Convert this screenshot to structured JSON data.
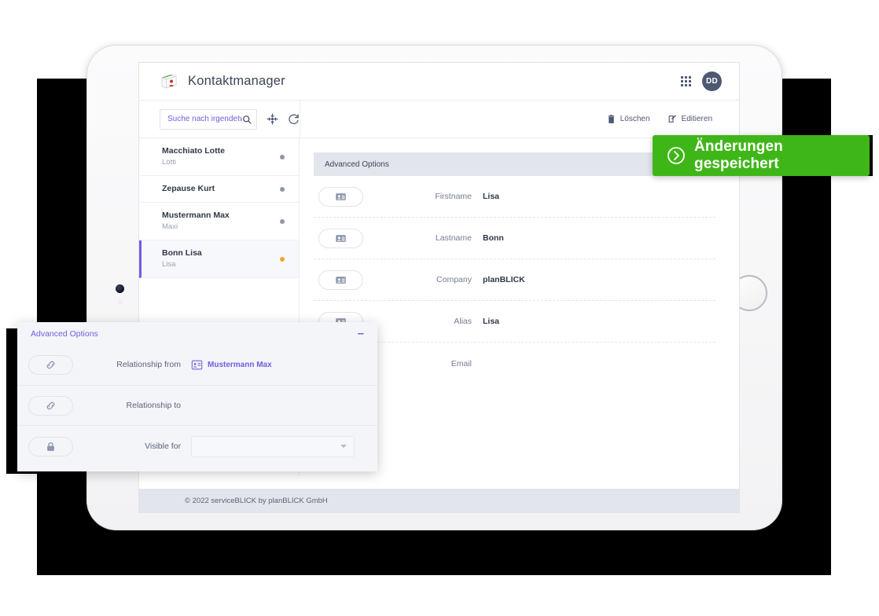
{
  "app": {
    "title": "Kontaktmanager",
    "logo_icon": "contact-book-icon",
    "apps_grid_icon": "apps-grid-icon",
    "avatar_initials": "DD"
  },
  "search": {
    "placeholder": "Suche nach irgendetwas...",
    "value": "",
    "search_icon": "search-icon",
    "add_icon": "move-add-icon",
    "refresh_icon": "refresh-icon"
  },
  "toolbar_actions": [
    {
      "label": "Löschen",
      "icon": "trash-icon"
    },
    {
      "label": "Editieren",
      "icon": "pencil-square-icon"
    }
  ],
  "contacts": [
    {
      "name": "Macchiato Lotte",
      "alias": "Lotti",
      "selected": false,
      "status_color": "#8e96ab"
    },
    {
      "name": "Zepause Kurt",
      "alias": "",
      "selected": false,
      "status_color": "#8e96ab"
    },
    {
      "name": "Mustermann Max",
      "alias": "Maxi",
      "selected": false,
      "status_color": "#8e96ab"
    },
    {
      "name": "Bonn Lisa",
      "alias": "Lisa",
      "selected": true,
      "status_color": "#f5a623"
    }
  ],
  "detail": {
    "section_title": "Advanced Options",
    "fields": [
      {
        "label": "Firstname",
        "value": "Lisa",
        "icon": "contact-card-icon"
      },
      {
        "label": "Lastname",
        "value": "Bonn",
        "icon": "contact-card-icon"
      },
      {
        "label": "Company",
        "value": "planBLICK",
        "icon": "contact-card-icon"
      },
      {
        "label": "Alias",
        "value": "Lisa",
        "icon": "contact-card-icon"
      },
      {
        "label": "Email",
        "value": "",
        "icon": "contact-card-icon"
      }
    ]
  },
  "overlay": {
    "title": "Advanced Options",
    "minimize_label": "–",
    "rows": [
      {
        "label": "Relationship from",
        "value": "Mustermann Max",
        "icon": "link-icon",
        "value_icon": "contact-card-icon"
      },
      {
        "label": "Relationship to",
        "value": "",
        "icon": "link-icon",
        "value_icon": ""
      },
      {
        "label": "Visible for",
        "value": "",
        "icon": "lock-icon",
        "value_icon": ""
      }
    ]
  },
  "toast": {
    "message": "Änderungen gespeichert",
    "icon": "circle-arrow-right-icon",
    "color": "#3fb618"
  },
  "footer": {
    "text": "© 2022 serviceBLICK by planBLICK GmbH"
  },
  "colors": {
    "accent": "#6e5fe0",
    "success": "#3fb618",
    "warning": "#f5a623",
    "text_dark": "#2f3747",
    "text_muted": "#737c90"
  }
}
